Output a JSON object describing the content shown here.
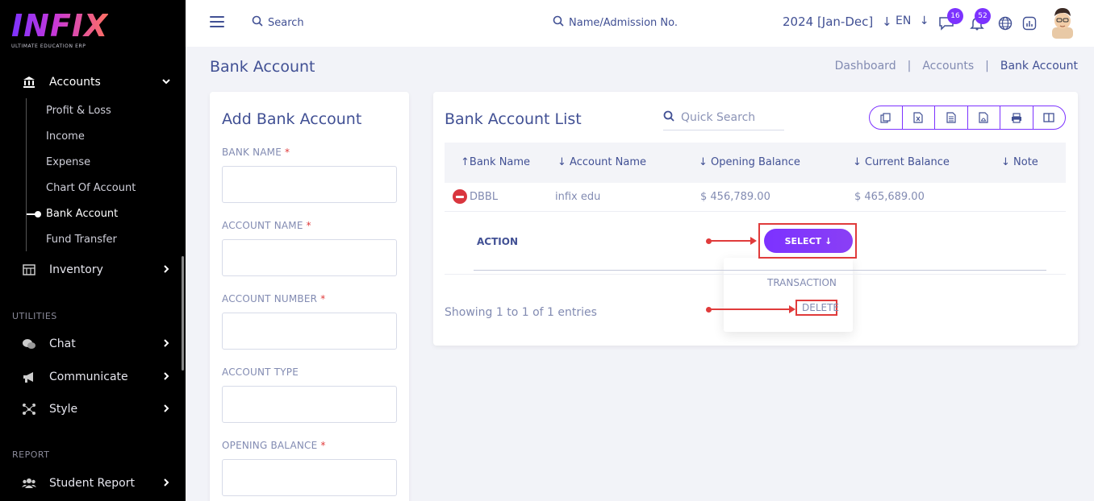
{
  "brand": {
    "name": "INFIX",
    "tagline": "ULTIMATE EDUCATION ERP"
  },
  "sidebar": {
    "accounts_label": "Accounts",
    "sub_items": [
      "Profit & Loss",
      "Income",
      "Expense",
      "Chart Of Account",
      "Bank Account",
      "Fund Transfer"
    ],
    "active_sub": "Bank Account",
    "inventory_label": "Inventory",
    "utilities_label": "UTILITIES",
    "chat_label": "Chat",
    "communicate_label": "Communicate",
    "style_label": "Style",
    "report_label": "REPORT",
    "student_report_label": "Student Report"
  },
  "topbar": {
    "search_label": "Search",
    "name_search_label": "Name/Admission No.",
    "year": "2024 [Jan-Dec]",
    "lang": "EN",
    "chat_badge": "16",
    "notif_badge": "52"
  },
  "page": {
    "title": "Bank Account",
    "breadcrumb": [
      "Dashboard",
      "Accounts",
      "Bank Account"
    ]
  },
  "form": {
    "title": "Add Bank Account",
    "fields": [
      {
        "label": "BANK NAME",
        "required": "*"
      },
      {
        "label": "ACCOUNT NAME",
        "required": "*"
      },
      {
        "label": "ACCOUNT NUMBER",
        "required": "*"
      },
      {
        "label": "ACCOUNT TYPE",
        "required": ""
      },
      {
        "label": "OPENING BALANCE",
        "required": "*"
      }
    ]
  },
  "list": {
    "title": "Bank Account List",
    "quick_search_placeholder": "Quick Search",
    "columns": [
      "Bank Name",
      "Account Name",
      "Opening Balance",
      "Current Balance",
      "Note"
    ],
    "rows": [
      {
        "bank_name": "DBBL",
        "account_name": "infix edu",
        "opening_balance": "$ 456,789.00",
        "current_balance": "$ 465,689.00",
        "note": ""
      }
    ],
    "action_label": "ACTION",
    "select_label": "SELECT",
    "dropdown_items": [
      "TRANSACTION",
      "DELETE"
    ],
    "showing": "Showing 1 to 1 of 1 entries"
  },
  "colors": {
    "accent": "#7c32ff",
    "highlight": "#e03b3b",
    "text": "#415094"
  }
}
